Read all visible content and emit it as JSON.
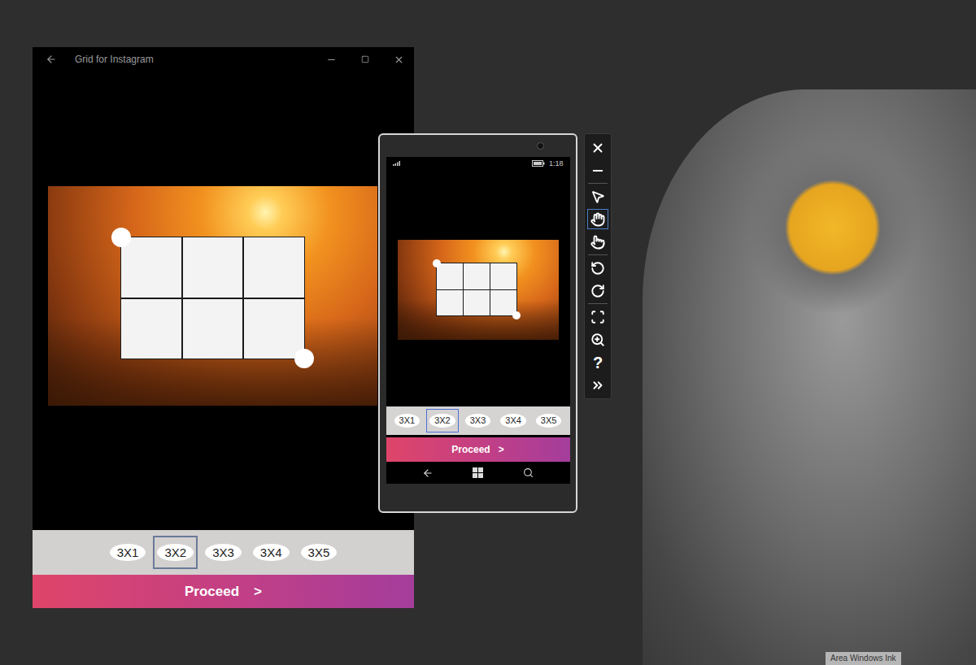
{
  "desktop_window": {
    "title": "Grid for Instagram"
  },
  "grid": {
    "columns": 3,
    "rows": 2
  },
  "grid_options": [
    {
      "label": "3X1",
      "selected": false
    },
    {
      "label": "3X2",
      "selected": true
    },
    {
      "label": "3X3",
      "selected": false
    },
    {
      "label": "3X4",
      "selected": false
    },
    {
      "label": "3X5",
      "selected": false
    }
  ],
  "proceed": {
    "label": "Proceed",
    "arrow": ">"
  },
  "phone": {
    "status_time": "1:18"
  },
  "emulator_toolbar": {
    "help": "?",
    "tools": [
      {
        "selected": false
      },
      {
        "selected": false
      },
      {
        "selected": false
      },
      {
        "selected": true
      },
      {
        "selected": false
      },
      {
        "selected": false
      },
      {
        "selected": false
      },
      {
        "selected": false
      },
      {
        "selected": false
      },
      {
        "selected": false
      }
    ]
  },
  "watermark": "Area Windows Ink"
}
